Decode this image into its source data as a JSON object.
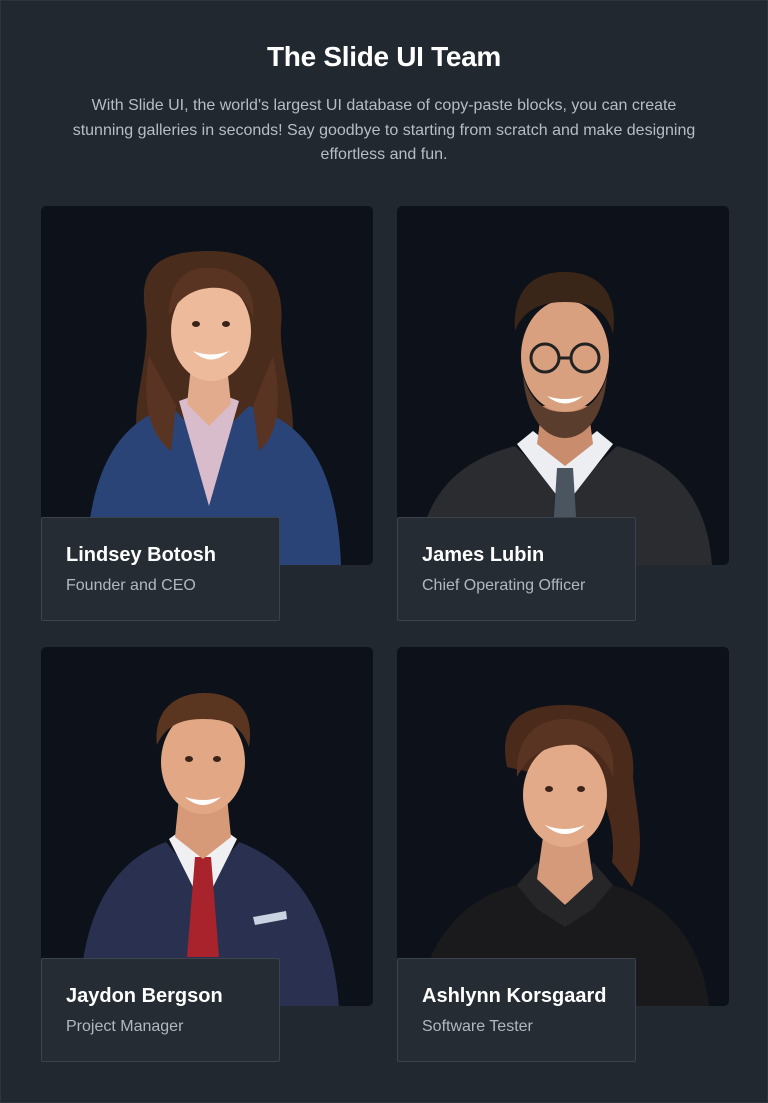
{
  "header": {
    "title": "The Slide UI Team",
    "description": "With Slide UI, the world's largest UI database of copy-paste blocks, you can create stunning galleries in seconds! Say goodbye to starting from scratch and make designing effortless and fun."
  },
  "team": [
    {
      "name": "Lindsey Botosh",
      "role": "Founder and CEO"
    },
    {
      "name": "James Lubin",
      "role": "Chief Operating Officer"
    },
    {
      "name": "Jaydon Bergson",
      "role": "Project Manager"
    },
    {
      "name": "Ashlynn Korsgaard",
      "role": "Software Tester"
    }
  ],
  "colors": {
    "background": "#222830",
    "photo_background": "#0d111a",
    "label_background": "#262c33",
    "label_border": "#3b434c",
    "text_primary": "#ffffff",
    "text_secondary": "#b2b8bf"
  }
}
